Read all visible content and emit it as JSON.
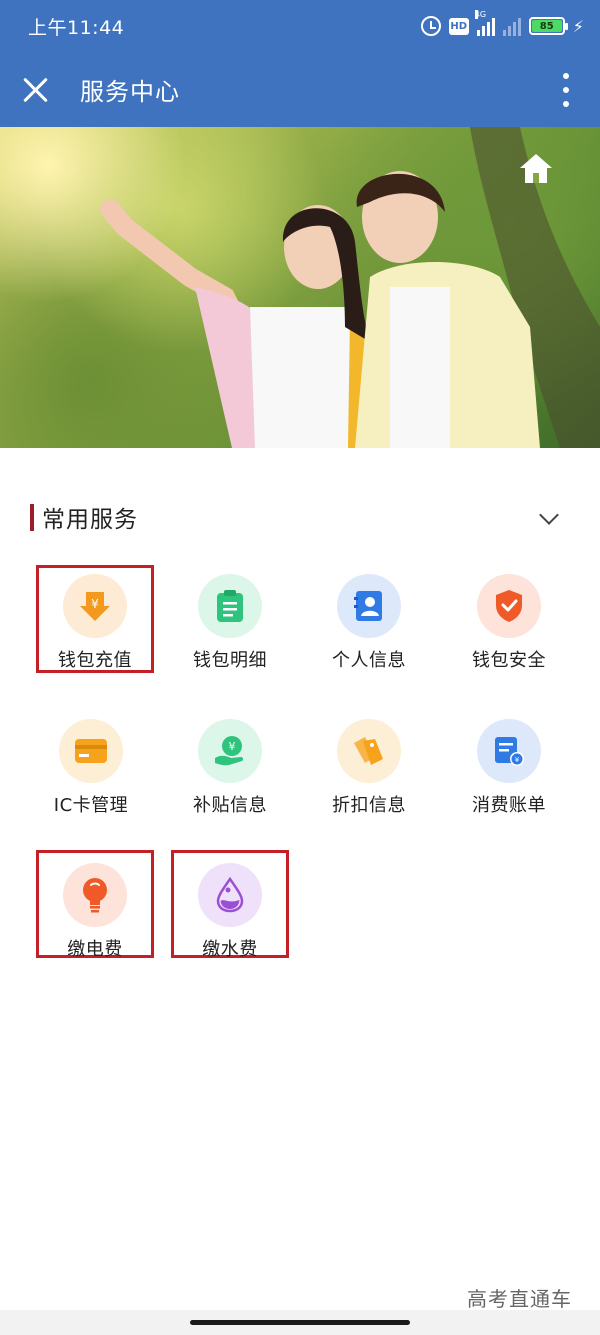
{
  "status_bar": {
    "time": "上午11:44",
    "network_label": "4G",
    "hd_label": "HD",
    "battery": "85"
  },
  "header": {
    "title": "服务中心"
  },
  "section": {
    "title": "常用服务"
  },
  "services": [
    {
      "label": "钱包充值",
      "icon": "wallet-recharge-icon",
      "color": "#f39a1e",
      "bg": "#fdebd5",
      "highlighted": true
    },
    {
      "label": "钱包明细",
      "icon": "clipboard-icon",
      "color": "#2ec47e",
      "bg": "#dcf6ea",
      "highlighted": false
    },
    {
      "label": "个人信息",
      "icon": "contact-card-icon",
      "color": "#2f7ae5",
      "bg": "#dde9fb",
      "highlighted": false
    },
    {
      "label": "钱包安全",
      "icon": "shield-icon",
      "color": "#f05a28",
      "bg": "#fde3d9",
      "highlighted": false
    },
    {
      "label": "IC卡管理",
      "icon": "card-icon",
      "color": "#f6a21a",
      "bg": "#fdeed6",
      "highlighted": false
    },
    {
      "label": "补贴信息",
      "icon": "subsidy-icon",
      "color": "#2ec47e",
      "bg": "#dcf6ea",
      "highlighted": false
    },
    {
      "label": "折扣信息",
      "icon": "discount-tag-icon",
      "color": "#f6a21a",
      "bg": "#fdeed6",
      "highlighted": false
    },
    {
      "label": "消费账单",
      "icon": "bill-icon",
      "color": "#2f7ae5",
      "bg": "#dde9fb",
      "highlighted": false
    },
    {
      "label": "缴电费",
      "icon": "lightbulb-icon",
      "color": "#f05a28",
      "bg": "#fde3d9",
      "highlighted": true
    },
    {
      "label": "缴水费",
      "icon": "water-drop-icon",
      "color": "#9b4fd6",
      "bg": "#efe1fa",
      "highlighted": true
    }
  ],
  "watermark": "高考直通车"
}
